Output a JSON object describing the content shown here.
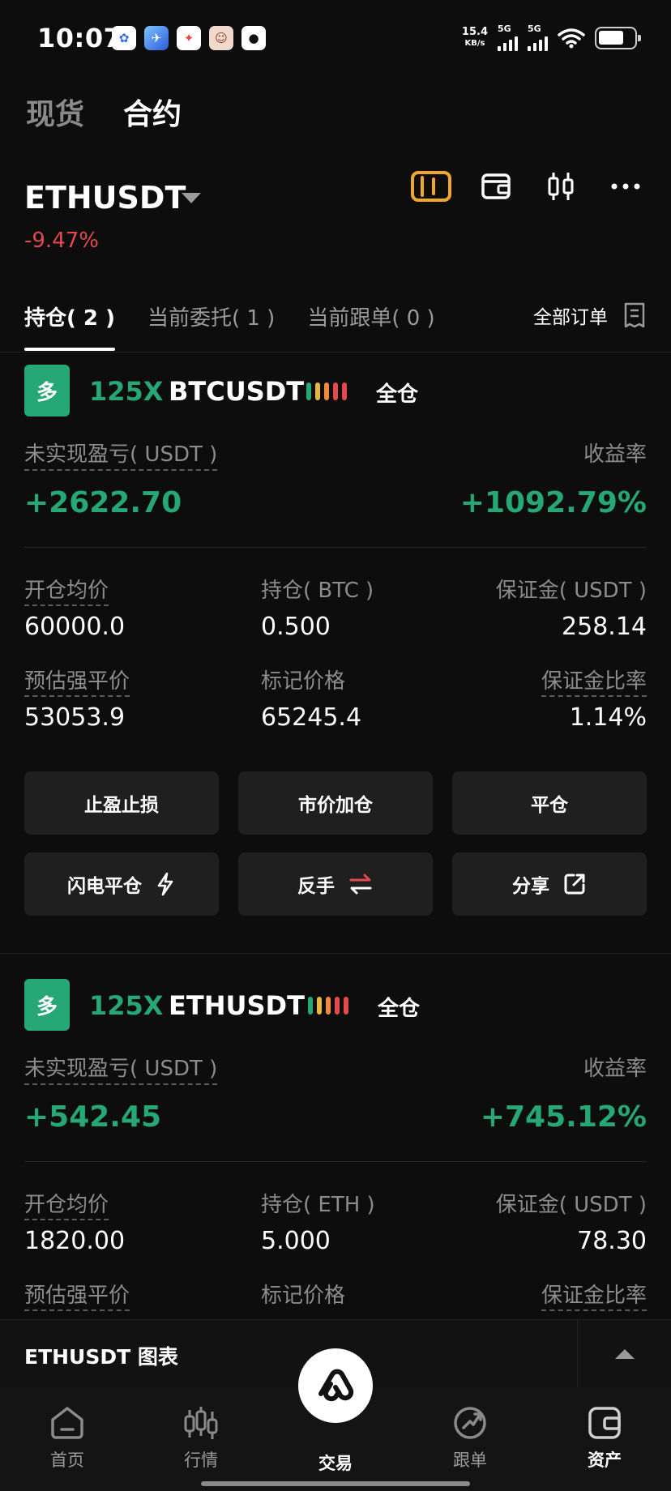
{
  "status_bar": {
    "time": "10:07",
    "net_speed_value": "15.4",
    "net_speed_unit": "KB/s",
    "sim1": "5G",
    "sim2": "5G",
    "apps": [
      "baidu",
      "bird",
      "app-3",
      "avatar",
      "qq"
    ]
  },
  "mode_tabs": [
    {
      "label": "现货",
      "active": false
    },
    {
      "label": "合约",
      "active": true
    }
  ],
  "header": {
    "symbol": "ETHUSDT",
    "change": "-9.47%",
    "icons": [
      "order-book-icon",
      "wallet-icon",
      "candlestick-icon",
      "more-icon"
    ]
  },
  "position_tabs": [
    {
      "label": "持仓( 2 )",
      "active": true
    },
    {
      "label": "当前委托( 1 )",
      "active": false
    },
    {
      "label": "当前跟单( 0 )",
      "active": false
    }
  ],
  "all_orders_label": "全部订单",
  "positions": [
    {
      "side": "多",
      "leverage": "125X",
      "pair": "BTCUSDT",
      "margin_mode": "全仓",
      "risk_colors": [
        "#25a776",
        "#e6b93c",
        "#f08a3c",
        "#e5484d",
        "#e5484d"
      ],
      "pnl_label": "未实现盈亏( USDT )",
      "roe_label": "收益率",
      "pnl": "+2622.70",
      "roe": "+1092.79%",
      "entry_label": "开仓均价",
      "entry": "60000.0",
      "size_label": "持仓( BTC )",
      "size": "0.500",
      "margin_label": "保证金( USDT )",
      "margin": "258.14",
      "liq_label": "预估强平价",
      "liq": "53053.9",
      "mark_label": "标记价格",
      "mark": "65245.4",
      "ratio_label": "保证金比率",
      "ratio": "1.14%",
      "buttons": {
        "tpsl": "止盈止损",
        "market_add": "市价加仓",
        "close": "平仓",
        "flash_close": "闪电平仓",
        "reverse": "反手",
        "share": "分享"
      }
    },
    {
      "side": "多",
      "leverage": "125X",
      "pair": "ETHUSDT",
      "margin_mode": "全仓",
      "risk_colors": [
        "#25a776",
        "#e6b93c",
        "#f08a3c",
        "#e5484d",
        "#e5484d"
      ],
      "pnl_label": "未实现盈亏( USDT )",
      "roe_label": "收益率",
      "pnl": "+542.45",
      "roe": "+745.12%",
      "entry_label": "开仓均价",
      "entry": "1820.00",
      "size_label": "持仓( ETH )",
      "size": "5.000",
      "margin_label": "保证金( USDT )",
      "margin": "78.30",
      "liq_label": "预估强平价",
      "mark_label": "标记价格",
      "ratio_label": "保证金比率"
    }
  ],
  "chart_bar": {
    "label": "ETHUSDT 图表"
  },
  "bottom_nav": [
    {
      "label": "首页",
      "icon": "home-icon",
      "active": false
    },
    {
      "label": "行情",
      "icon": "market-icon",
      "active": false
    },
    {
      "label": "交易",
      "icon": "trade-icon",
      "active": true
    },
    {
      "label": "跟单",
      "icon": "copy-trade-icon",
      "active": false
    },
    {
      "label": "资产",
      "icon": "assets-icon",
      "active": false
    }
  ],
  "colors": {
    "up": "#25a776",
    "down": "#e5484d",
    "accent": "#f0a82c",
    "background": "#0d0d0d"
  }
}
